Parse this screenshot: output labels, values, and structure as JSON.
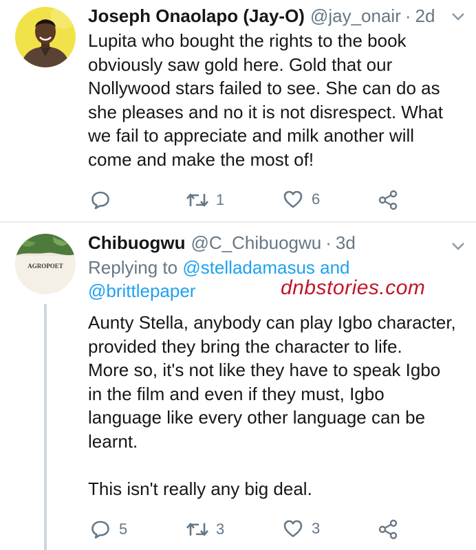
{
  "tweets": [
    {
      "author": {
        "name": "Joseph Onaolapo (Jay-O)",
        "handle": "@jay_onair",
        "time": "2d"
      },
      "separator": "·",
      "text": "Lupita who bought the rights to the book\nobviously saw gold here. Gold that our\nNollywood stars failed to see. She can do as\nshe pleases and no it is not disrespect. What\nwe fail to appreciate and milk another will\ncome and make the most of!",
      "stats": {
        "replies": "",
        "retweets": "1",
        "likes": "6"
      }
    },
    {
      "author": {
        "name": "Chibuogwu",
        "handle": "@C_Chibuogwu",
        "time": "3d"
      },
      "separator": "·",
      "avatar_text": "AGROPOET",
      "replying": {
        "prefix": "Replying to",
        "mention1": "@stelladamasus",
        "conj": "and",
        "mention2": "@brittlepaper"
      },
      "text": "Aunty Stella, anybody can play Igbo character,\nprovided they bring the character to life.\nMore so, it's not like they have to speak Igbo\nin the film and even if they must, Igbo\nlanguage like every other language can be\nlearnt.\n\nThis isn't really any big deal.",
      "stats": {
        "replies": "5",
        "retweets": "3",
        "likes": "3"
      }
    }
  ],
  "watermark": "dnbstories.com",
  "colors": {
    "text": "#14171a",
    "secondary": "#657786",
    "link": "#1da1f2",
    "watermark": "#c0152a",
    "divider": "#e6ecf0"
  }
}
